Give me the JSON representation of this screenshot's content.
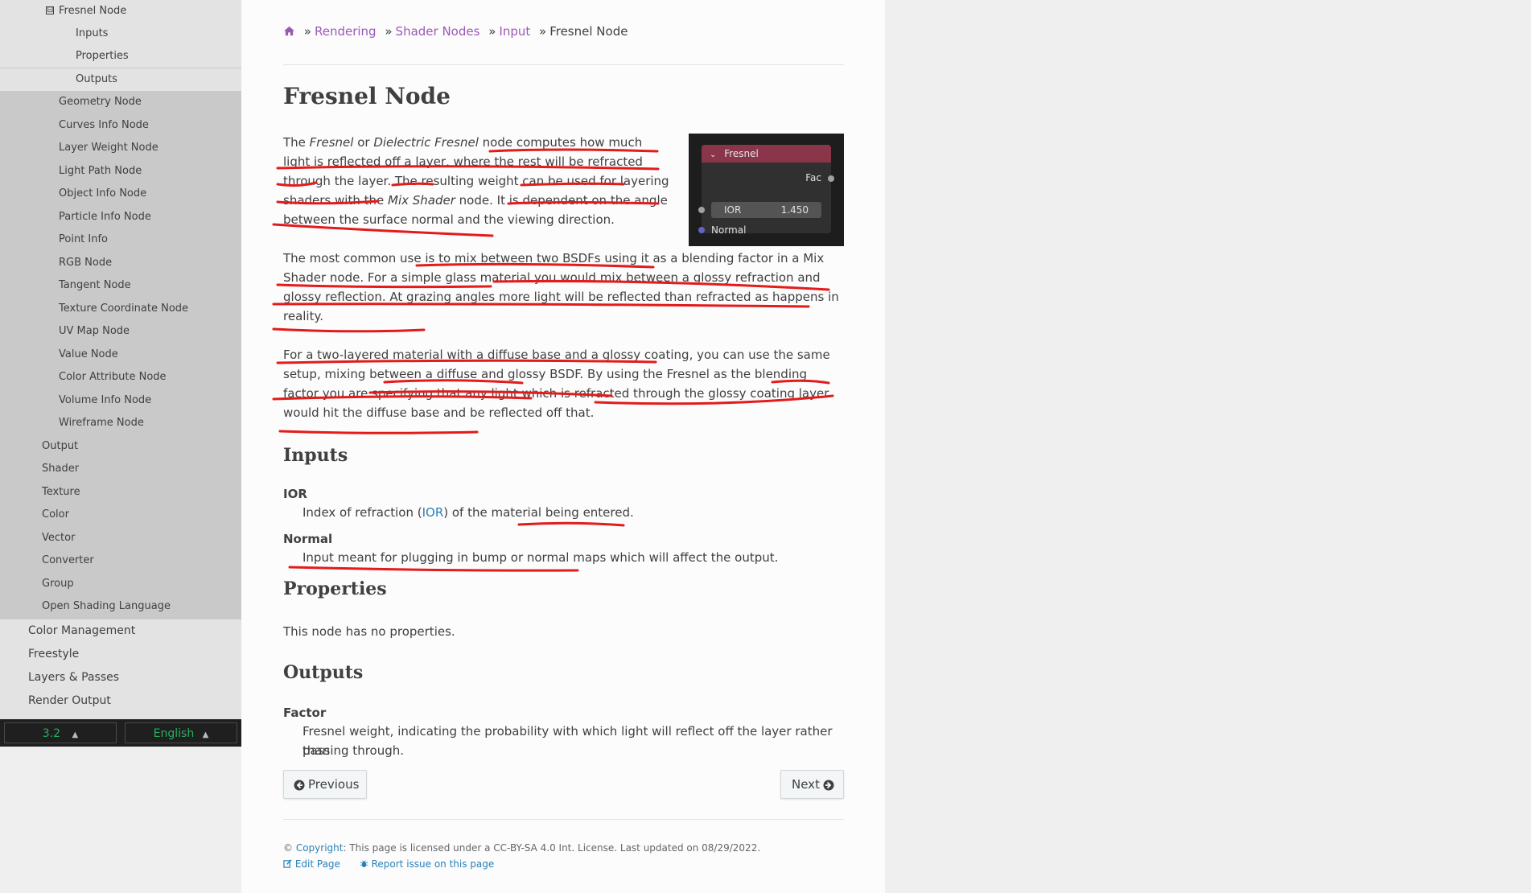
{
  "sidebar": {
    "items": [
      {
        "label": "Fresnel Node",
        "expanded_marker": "⊟"
      },
      {
        "label": "Inputs"
      },
      {
        "label": "Properties"
      },
      {
        "label": "Outputs"
      },
      {
        "label": "Geometry Node"
      },
      {
        "label": "Curves Info Node"
      },
      {
        "label": "Layer Weight Node"
      },
      {
        "label": "Light Path Node"
      },
      {
        "label": "Object Info Node"
      },
      {
        "label": "Particle Info Node"
      },
      {
        "label": "Point Info"
      },
      {
        "label": "RGB Node"
      },
      {
        "label": "Tangent Node"
      },
      {
        "label": "Texture Coordinate Node"
      },
      {
        "label": "UV Map Node"
      },
      {
        "label": "Value Node"
      },
      {
        "label": "Color Attribute Node"
      },
      {
        "label": "Volume Info Node"
      },
      {
        "label": "Wireframe Node"
      },
      {
        "label": "Output"
      },
      {
        "label": "Shader"
      },
      {
        "label": "Texture"
      },
      {
        "label": "Color"
      },
      {
        "label": "Vector"
      },
      {
        "label": "Converter"
      },
      {
        "label": "Group"
      },
      {
        "label": "Open Shading Language"
      },
      {
        "label": "Color Management"
      },
      {
        "label": "Freestyle"
      },
      {
        "label": "Layers & Passes"
      },
      {
        "label": "Render Output"
      }
    ],
    "version": {
      "label": "3.2",
      "arrow": "▲"
    },
    "language": {
      "label": "English",
      "arrow": "▲"
    }
  },
  "breadcrumbs": {
    "items": [
      "Rendering",
      "Shader Nodes",
      "Input"
    ],
    "current": "Fresnel Node",
    "sep": "»"
  },
  "title": "Fresnel Node",
  "intro": {
    "p1": {
      "t1": "The ",
      "i1": "Fresnel",
      "t2": " or ",
      "i2": "Dielectric Fresnel",
      "t3": " node computes how much light is reflected off a layer, where the rest will be refracted through the layer. The resulting weight can be used for layering shaders with the ",
      "i3": "Mix Shader",
      "t4": " node. It is dependent on the angle between the surface normal and the viewing direction."
    },
    "p2": "The most common use is to mix between two BSDFs using it as a blending factor in a Mix Shader node. For a simple glass material you would mix between a glossy refraction and glossy reflection. At grazing angles more light will be reflected than refracted as happens in reality.",
    "p3": "For a two-layered material with a diffuse base and a glossy coating, you can use the same setup, mixing between a diffuse and glossy BSDF. By using the Fresnel as the blending factor you are specifying that any light which is refracted through the glossy coating layer would hit the diffuse base and be reflected off that."
  },
  "node_image": {
    "title": "Fresnel",
    "output": "Fac",
    "ior_label": "IOR",
    "ior_value": "1.450",
    "normal_label": "Normal",
    "header_color": "#8a3549",
    "socket_grey": "#a1a1a1",
    "socket_blue": "#6363c7"
  },
  "inputs": {
    "heading": "Inputs",
    "ior": {
      "term": "IOR",
      "desc_pre": "Index of refraction (",
      "desc_link": "IOR",
      "desc_post": ") of the material being entered."
    },
    "normal": {
      "term": "Normal",
      "desc": "Input meant for plugging in bump or normal maps which will affect the output."
    }
  },
  "properties": {
    "heading": "Properties",
    "text": "This node has no properties."
  },
  "outputs": {
    "heading": "Outputs",
    "factor": {
      "term": "Factor",
      "desc_l1": "Fresnel weight, indicating the probability with which light will reflect off the layer rather than",
      "desc_l2": "passing through."
    }
  },
  "nav": {
    "previous": "Previous",
    "next": "Next"
  },
  "footer": {
    "copyright_symbol": "©",
    "copyright_link": "Copyright",
    "license_text": ": This page is licensed under a CC-BY-SA 4.0 Int. License. Last updated on 08/29/2022.",
    "edit_page": "Edit Page",
    "report_issue": "Report issue on this page"
  },
  "colors": {
    "link": "#2980b9",
    "crumb": "#9b59b6",
    "annotation": "#e31b1b",
    "version": "#27ae60"
  }
}
